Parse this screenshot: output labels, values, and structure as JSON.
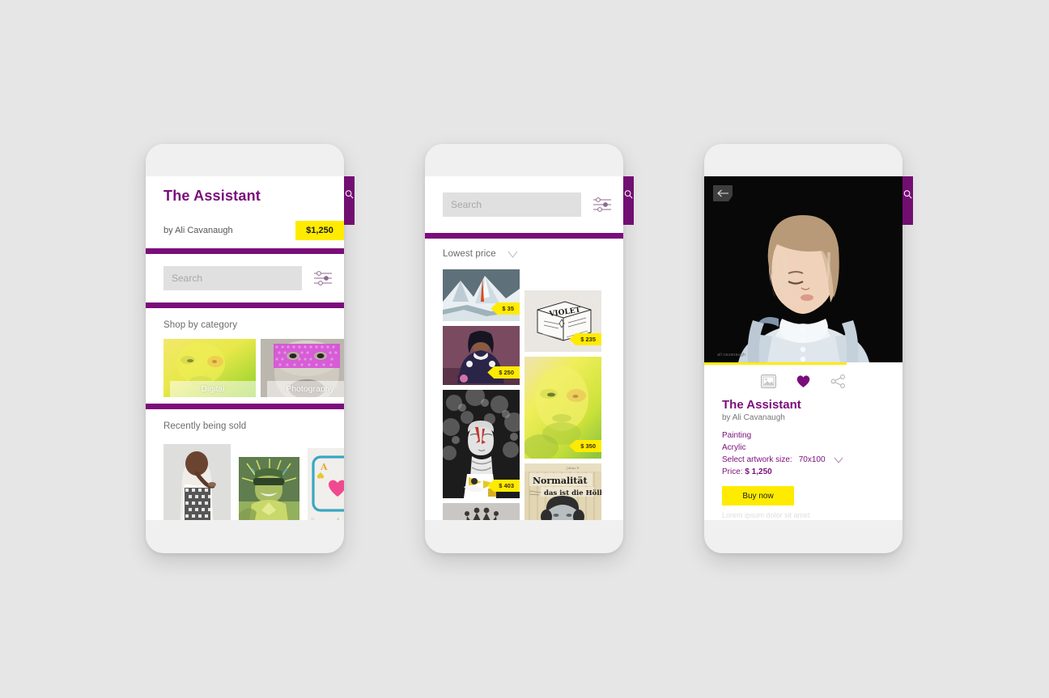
{
  "theme": {
    "purple": "#7b0d7b",
    "yellow": "#ffeb00",
    "bg": "#e6e6e6",
    "frame": "#f0f0f0"
  },
  "phone1": {
    "name": "home-screen",
    "featured": {
      "title": "The Assistant",
      "byline": "by Ali Cavanaugh",
      "price": "$1,250"
    },
    "search": {
      "placeholder": "Search",
      "value": "",
      "filter_icon": "sliders-icon"
    },
    "categories": {
      "heading": "Shop by category",
      "tiles": [
        {
          "label": "Digital",
          "art": "yellow-green-face"
        },
        {
          "label": "Photography",
          "art": "dotted-mask-child"
        }
      ]
    },
    "recent": {
      "heading": "Recently being sold",
      "items": [
        {
          "art": "girl-braid-gingham"
        },
        {
          "art": "blindfolded-man-green"
        },
        {
          "art": "ace-of-hearts-card"
        }
      ]
    },
    "edge_tab_icon": "search-icon"
  },
  "phone2": {
    "name": "browse-screen",
    "search": {
      "placeholder": "Search",
      "value": "",
      "filter_icon": "sliders-icon"
    },
    "sort": {
      "label": "Lowest price",
      "icon": "chevron-down-icon"
    },
    "grid": {
      "left_column": [
        {
          "art": "snow-mountain",
          "price": "$ 35"
        },
        {
          "art": "seated-woman-purple",
          "price": "$ 250"
        },
        {
          "art": "painted-face-bw",
          "price": "$ 403"
        },
        {
          "art": "crown-sketch",
          "price": ""
        }
      ],
      "right_column": [
        {
          "art": "violet-box-drawing",
          "price": "$ 235"
        },
        {
          "art": "yellow-green-face",
          "price": "$ 350"
        },
        {
          "art": "normalitaet-poster",
          "price": ""
        }
      ]
    },
    "edge_tab_icon": "search-icon"
  },
  "phone3": {
    "name": "artwork-detail-screen",
    "back_icon": "back-arrow-icon",
    "hero_art": "girl-white-dress-portrait",
    "actions": [
      {
        "icon": "frame-preview-icon",
        "name": "preview-on-wall-button"
      },
      {
        "icon": "heart-icon",
        "name": "favorite-button"
      },
      {
        "icon": "share-icon",
        "name": "share-button"
      }
    ],
    "detail": {
      "title": "The Assistant",
      "byline": "by Ali Cavanaugh",
      "medium": "Painting",
      "material": "Acrylic",
      "size_label": "Select artwork size:",
      "size_value": "70x100",
      "size_icon": "chevron-down-icon",
      "price_label": "Price:",
      "price_value": "$ 1,250",
      "buy_label": "Buy now",
      "footnote": "Lorem ipsum dolor sit amet"
    },
    "edge_tab_icon": "search-icon"
  }
}
